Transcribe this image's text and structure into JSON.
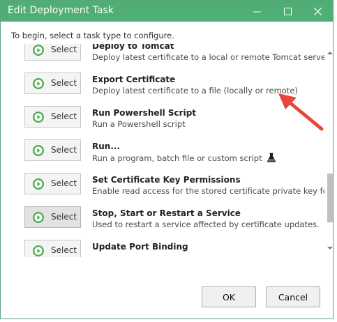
{
  "window": {
    "title": "Edit Deployment Task",
    "minimize_icon": "minimize-icon",
    "maximize_icon": "maximize-icon",
    "close_icon": "close-icon"
  },
  "intro_text": "To begin, select a task type to configure.",
  "select_label": "Select",
  "tasks": [
    {
      "title": "Deploy to Tomcat",
      "description": "Deploy latest certificate to a local or remote Tomcat server"
    },
    {
      "title": "Export Certificate",
      "description": "Deploy latest certificate to a file (locally or remote)"
    },
    {
      "title": "Run Powershell Script",
      "description": "Run a Powershell script"
    },
    {
      "title": "Run...",
      "description": "Run a program, batch file or custom script"
    },
    {
      "title": "Set Certificate Key Permissions",
      "description": "Enable read access for the stored certificate private key for"
    },
    {
      "title": "Stop, Start or Restart a Service",
      "description": "Used to restart a service affected by certificate updates."
    },
    {
      "title": "Update Port Binding",
      "description": ""
    }
  ],
  "buttons": {
    "ok": "OK",
    "cancel": "Cancel"
  },
  "colors": {
    "titlebar": "#4fae74",
    "play_icon": "#4caf50",
    "annotation_arrow": "#e8463a"
  },
  "icons": {
    "select_icon": "play-circle-icon",
    "flask": "flask-icon"
  }
}
